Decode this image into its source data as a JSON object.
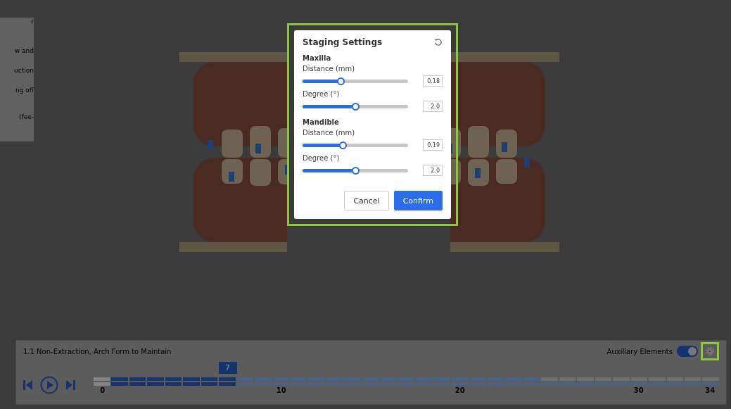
{
  "side_panel": {
    "lines": [
      "r",
      "w and",
      "uction",
      "ng off",
      "(fee-"
    ]
  },
  "dialog": {
    "title": "Staging Settings",
    "highlighted": true,
    "groups": [
      {
        "title": "Maxilla",
        "sliders": [
          {
            "label": "Distance (mm)",
            "level": 0.36,
            "value": "0.18"
          },
          {
            "label": "Degree (°)",
            "level": 0.5,
            "value": "2.0"
          }
        ]
      },
      {
        "title": "Mandible",
        "sliders": [
          {
            "label": "Distance (mm)",
            "level": 0.38,
            "value": "0.19"
          },
          {
            "label": "Degree (°)",
            "level": 0.5,
            "value": "2.0"
          }
        ]
      }
    ],
    "buttons": [
      {
        "label": "Cancel",
        "kind": "secondary"
      },
      {
        "label": "Confirm",
        "kind": "primary"
      }
    ]
  },
  "timeline": {
    "plan_name": "1.1 Non-Extraction, Arch Form to Maintain",
    "auxiliary_label": "Auxiliary Elements",
    "auxiliary_on": true,
    "settings_highlighted": true,
    "current_step": "7",
    "upper": [
      {
        "kind": "base"
      },
      {
        "kind": "done"
      },
      {
        "kind": "done"
      },
      {
        "kind": "done"
      },
      {
        "kind": "done"
      },
      {
        "kind": "done"
      },
      {
        "kind": "done"
      },
      {
        "kind": "done"
      },
      {
        "kind": "planned"
      },
      {
        "kind": "planned"
      },
      {
        "kind": "planned"
      },
      {
        "kind": "planned"
      },
      {
        "kind": "planned"
      },
      {
        "kind": "planned"
      },
      {
        "kind": "planned"
      },
      {
        "kind": "planned"
      },
      {
        "kind": "planned"
      },
      {
        "kind": "planned"
      },
      {
        "kind": "planned"
      },
      {
        "kind": "planned"
      },
      {
        "kind": "planned"
      },
      {
        "kind": "planned"
      },
      {
        "kind": "planned"
      },
      {
        "kind": "planned"
      },
      {
        "kind": "planned"
      },
      {
        "kind": "none"
      },
      {
        "kind": "none"
      },
      {
        "kind": "none"
      },
      {
        "kind": "none"
      },
      {
        "kind": "none"
      },
      {
        "kind": "none"
      },
      {
        "kind": "none"
      },
      {
        "kind": "none"
      },
      {
        "kind": "none"
      },
      {
        "kind": "none"
      }
    ],
    "lower": [
      {
        "kind": "base"
      },
      {
        "kind": "done"
      },
      {
        "kind": "done"
      },
      {
        "kind": "done"
      },
      {
        "kind": "done"
      },
      {
        "kind": "done"
      },
      {
        "kind": "done"
      },
      {
        "kind": "done"
      },
      {
        "kind": "planned"
      },
      {
        "kind": "planned"
      },
      {
        "kind": "planned"
      },
      {
        "kind": "planned"
      },
      {
        "kind": "planned"
      },
      {
        "kind": "planned"
      },
      {
        "kind": "planned"
      },
      {
        "kind": "planned"
      },
      {
        "kind": "planned"
      },
      {
        "kind": "planned"
      },
      {
        "kind": "planned"
      },
      {
        "kind": "planned"
      },
      {
        "kind": "planned"
      },
      {
        "kind": "planned"
      },
      {
        "kind": "planned"
      },
      {
        "kind": "planned"
      },
      {
        "kind": "planned"
      },
      {
        "kind": "planned"
      },
      {
        "kind": "planned"
      },
      {
        "kind": "planned"
      },
      {
        "kind": "planned"
      },
      {
        "kind": "planned"
      },
      {
        "kind": "planned"
      },
      {
        "kind": "planned"
      },
      {
        "kind": "planned"
      },
      {
        "kind": "planned"
      },
      {
        "kind": "planned"
      }
    ],
    "ticks": [
      "0",
      "10",
      "20",
      "30",
      "34"
    ]
  }
}
